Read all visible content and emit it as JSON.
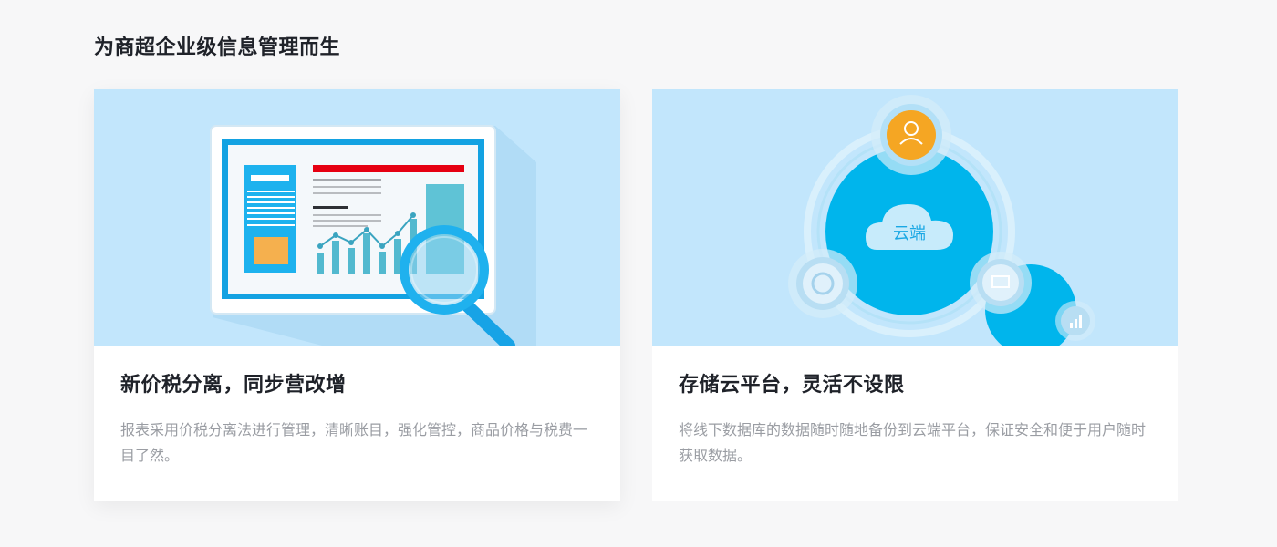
{
  "section": {
    "title": "为商超企业级信息管理而生"
  },
  "cards": [
    {
      "title": "新价税分离，同步营改增",
      "description": "报表采用价税分离法进行管理，清晰账目，强化管控，商品价格与税费一目了然。",
      "illustration": "report-magnifier-illustration"
    },
    {
      "title": "存储云平台，灵活不设限",
      "description": "将线下数据库的数据随时随地备份到云端平台，保证安全和便于用户随时获取数据。",
      "illustration": "cloud-platform-illustration",
      "cloud_label": "云端"
    }
  ],
  "colors": {
    "illustration_bg": "#c2e6fc",
    "accent_blue": "#00b4ec",
    "accent_orange": "#f5a623",
    "red_bar": "#e60012"
  }
}
